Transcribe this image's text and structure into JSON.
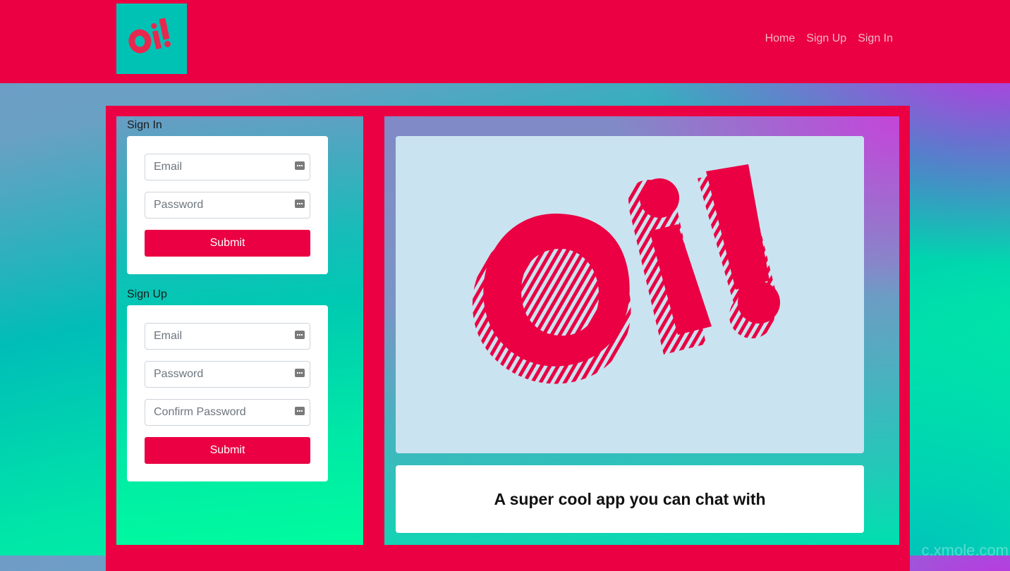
{
  "header": {
    "logo_text": "Oi!",
    "nav": [
      {
        "label": "Home"
      },
      {
        "label": "Sign Up"
      },
      {
        "label": "Sign In"
      }
    ]
  },
  "sign_in": {
    "heading": "Sign In",
    "email_placeholder": "Email",
    "password_placeholder": "Password",
    "submit_label": "Submit"
  },
  "sign_up": {
    "heading": "Sign Up",
    "email_placeholder": "Email",
    "password_placeholder": "Password",
    "confirm_placeholder": "Confirm Password",
    "submit_label": "Submit"
  },
  "hero": {
    "logo_text": "Oi!",
    "tagline": "A super cool app you can chat with"
  },
  "watermark": "c.xmole.com",
  "colors": {
    "brand": "#ea0043",
    "logo_bg": "#00c2b4",
    "hero_bg": "#cae3f0"
  },
  "icons": {
    "field_icon": "password-key-icon"
  }
}
